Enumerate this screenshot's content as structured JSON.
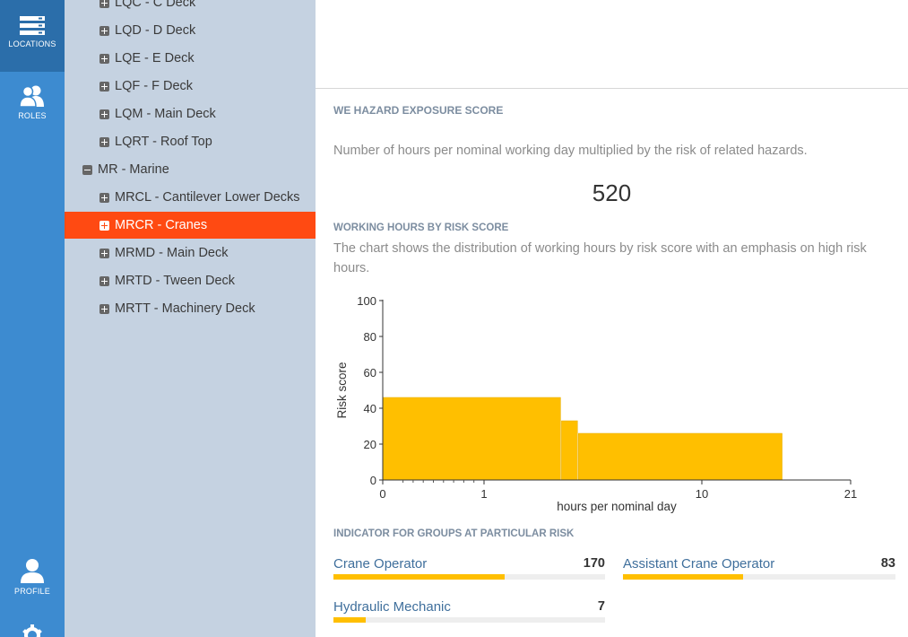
{
  "nav": {
    "locations_label": "LOCATIONS",
    "roles_label": "ROLES",
    "profile_label": "PROFILE"
  },
  "tree": {
    "rows": [
      {
        "label": "LQC - C Deck",
        "level": 2,
        "toggle": "plus",
        "selected": false
      },
      {
        "label": "LQD - D Deck",
        "level": 2,
        "toggle": "plus",
        "selected": false
      },
      {
        "label": "LQE - E Deck",
        "level": 2,
        "toggle": "plus",
        "selected": false
      },
      {
        "label": "LQF - F Deck",
        "level": 2,
        "toggle": "plus",
        "selected": false
      },
      {
        "label": "LQM - Main Deck",
        "level": 2,
        "toggle": "plus",
        "selected": false
      },
      {
        "label": "LQRT - Roof Top",
        "level": 2,
        "toggle": "plus",
        "selected": false
      },
      {
        "label": "MR - Marine",
        "level": 1,
        "toggle": "minus",
        "selected": false
      },
      {
        "label": "MRCL - Cantilever Lower Decks",
        "level": 2,
        "toggle": "plus",
        "selected": false
      },
      {
        "label": "MRCR - Cranes",
        "level": 2,
        "toggle": "plus",
        "selected": true
      },
      {
        "label": "MRMD - Main Deck",
        "level": 2,
        "toggle": "plus",
        "selected": false
      },
      {
        "label": "MRTD - Tween Deck",
        "level": 2,
        "toggle": "plus",
        "selected": false
      },
      {
        "label": "MRTT - Machinery Deck",
        "level": 2,
        "toggle": "plus",
        "selected": false
      }
    ]
  },
  "exposure": {
    "title": "WE HAZARD EXPOSURE SCORE",
    "description": "Number of hours per nominal working day multiplied by the risk of related hazards.",
    "score": "520"
  },
  "working_hours": {
    "title": "WORKING HOURS BY RISK SCORE",
    "description": "The chart shows the distribution of working hours by risk score with an emphasis on high risk hours."
  },
  "chart_data": {
    "type": "bar",
    "xlabel": "hours per nominal day",
    "ylabel": "Risk score",
    "ylim": [
      0,
      100
    ],
    "yticks": [
      "0",
      "20",
      "40",
      "60",
      "80",
      "100"
    ],
    "xticks": [
      "0",
      "1",
      "10",
      "21"
    ],
    "bars": [
      {
        "x_start": 0,
        "x_end": 4.2,
        "value": 46
      },
      {
        "x_start": 4.2,
        "x_end": 4.9,
        "value": 33
      },
      {
        "x_start": 4.9,
        "x_end": 16,
        "value": 26
      }
    ],
    "color": "#ffbf00",
    "grid": false
  },
  "indicator": {
    "title": "INDICATOR FOR GROUPS AT PARTICULAR RISK",
    "groups": [
      {
        "name": "Crane Operator",
        "value": "170",
        "fraction": 0.63
      },
      {
        "name": "Assistant Crane Operator",
        "value": "83",
        "fraction": 0.44
      },
      {
        "name": "Hydraulic Mechanic",
        "value": "7",
        "fraction": 0.12
      }
    ]
  }
}
